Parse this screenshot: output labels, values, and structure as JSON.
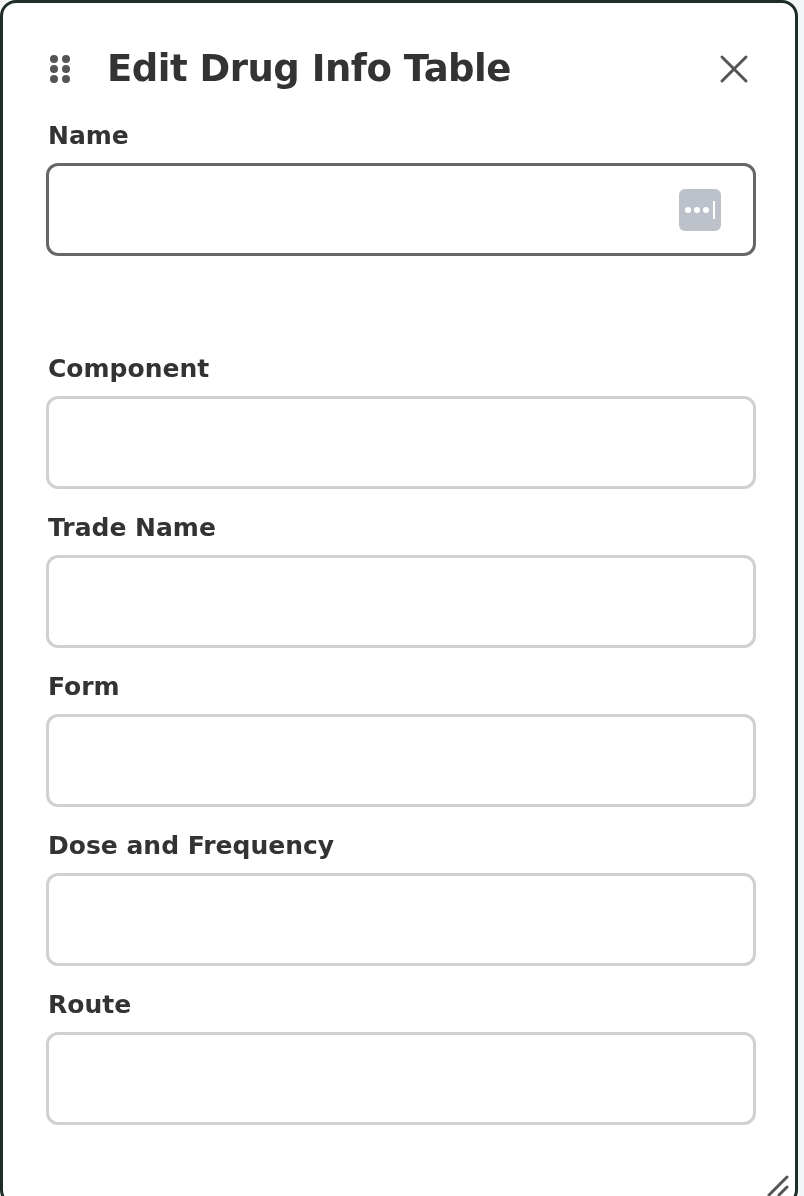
{
  "dialog": {
    "title": "Edit Drug Info Table"
  },
  "fields": [
    {
      "label": "Name",
      "focused": true,
      "kind": "password"
    },
    {
      "label": "Component",
      "focused": false,
      "kind": "text"
    },
    {
      "label": "Trade Name",
      "focused": false,
      "kind": "text"
    },
    {
      "label": "Form",
      "focused": false,
      "kind": "text"
    },
    {
      "label": "Dose and Frequency",
      "focused": false,
      "kind": "text"
    },
    {
      "label": "Route",
      "focused": false,
      "kind": "text"
    }
  ]
}
